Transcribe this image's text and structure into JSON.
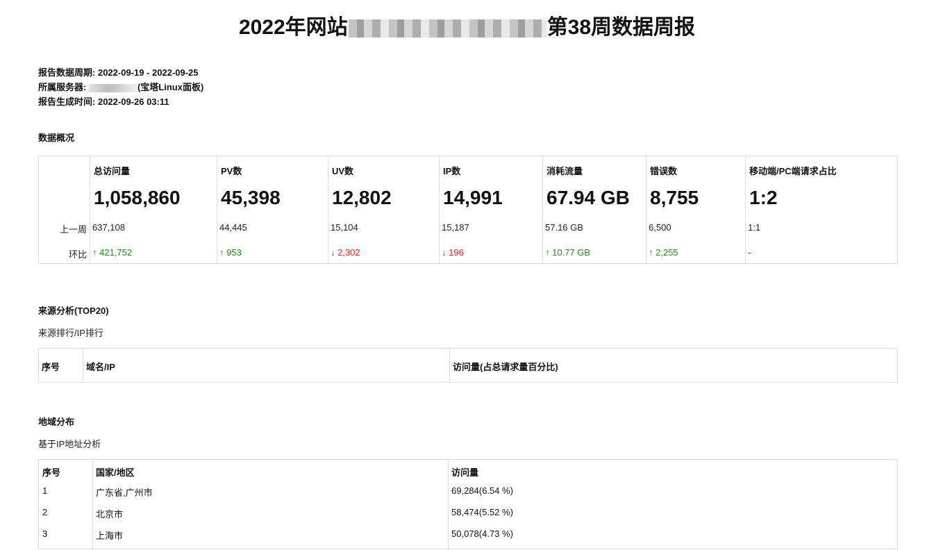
{
  "title": {
    "prefix": "2022年网站",
    "suffix": "第38周数据周报"
  },
  "meta": {
    "period_label": "报告数据周期:",
    "period_value": "2022-09-19 - 2022-09-25",
    "server_label": "所属服务器:",
    "server_suffix": "(宝塔Linux面板)",
    "generated_label": "报告生成时间:",
    "generated_value": "2022-09-26 03:11"
  },
  "overview": {
    "section_title": "数据概况",
    "row_labels": {
      "prev": "上一周",
      "change": "环比"
    },
    "columns": [
      {
        "header": "总访问量",
        "value": "1,058,860",
        "prev": "637,108",
        "change": "↑ 421,752",
        "trend": "up"
      },
      {
        "header": "PV数",
        "value": "45,398",
        "prev": "44,445",
        "change": "↑ 953",
        "trend": "up"
      },
      {
        "header": "UV数",
        "value": "12,802",
        "prev": "15,104",
        "change": "↓ 2,302",
        "trend": "down"
      },
      {
        "header": "IP数",
        "value": "14,991",
        "prev": "15,187",
        "change": "↓ 196",
        "trend": "down"
      },
      {
        "header": "消耗流量",
        "value": "67.94 GB",
        "prev": "57.16 GB",
        "change": "↑ 10.77 GB",
        "trend": "up"
      },
      {
        "header": "错误数",
        "value": "8,755",
        "prev": "6,500",
        "change": "↑ 2,255",
        "trend": "up"
      },
      {
        "header": "移动端/PC端请求占比",
        "value": "1:2",
        "prev": "1:1",
        "change": "-",
        "trend": "neutral"
      }
    ]
  },
  "source": {
    "section_title": "来源分析(TOP20)",
    "subtitle": "来源排行/IP排行",
    "headers": [
      "序号",
      "域名/IP",
      "访问量(占总请求量百分比)"
    ]
  },
  "region": {
    "section_title": "地域分布",
    "subtitle": "基于IP地址分析",
    "headers": [
      "序号",
      "国家/地区",
      "访问量"
    ],
    "rows": [
      {
        "index": "1",
        "region": "广东省,广州市",
        "visits": "69,284(6.54 %)"
      },
      {
        "index": "2",
        "region": "北京市",
        "visits": "58,474(5.52 %)"
      },
      {
        "index": "3",
        "region": "上海市",
        "visits": "50,078(4.73 %)"
      }
    ]
  },
  "colors": {
    "up": "#1a8a1a",
    "down": "#e01b1b",
    "border": "#dcdcdc"
  }
}
